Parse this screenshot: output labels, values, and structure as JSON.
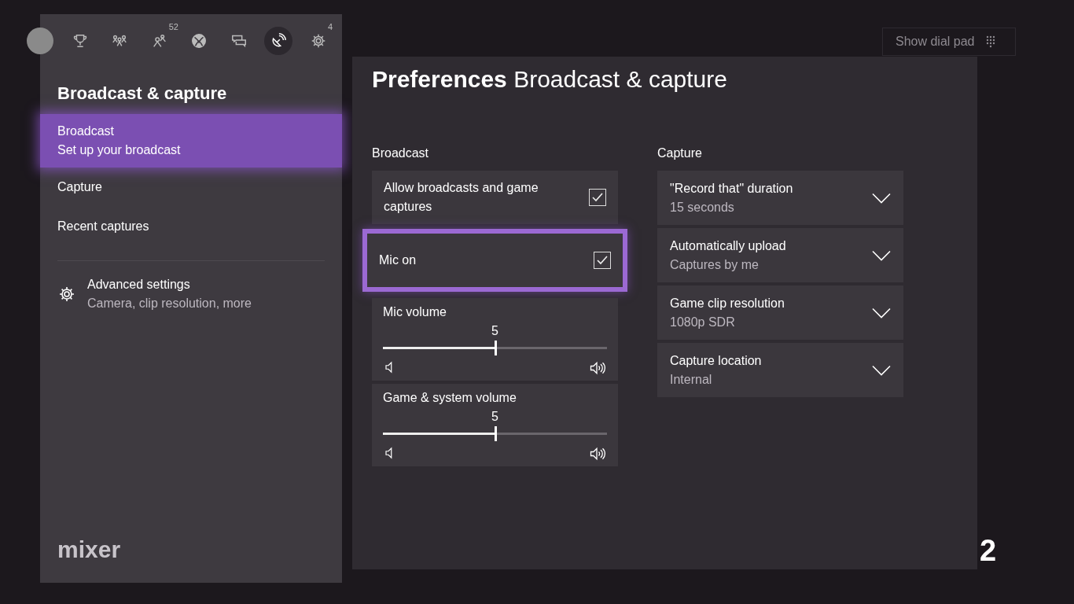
{
  "dial_pad_button": {
    "label": "Show dial pad"
  },
  "background_fragment": "2",
  "guide": {
    "tabs": [
      {
        "kind": "avatar",
        "selected": false
      },
      {
        "kind": "trophy",
        "selected": false
      },
      {
        "kind": "people",
        "selected": false
      },
      {
        "kind": "friends",
        "selected": false,
        "badge": "52"
      },
      {
        "kind": "xbox",
        "selected": false
      },
      {
        "kind": "chat",
        "selected": false
      },
      {
        "kind": "broadcast",
        "selected": true
      },
      {
        "kind": "gear",
        "selected": false,
        "badge": "4"
      }
    ],
    "title": "Broadcast & capture",
    "items": [
      {
        "label": "Broadcast",
        "sublabel": "Set up your broadcast",
        "selected": true
      },
      {
        "label": "Capture",
        "selected": false
      },
      {
        "label": "Recent captures",
        "selected": false
      }
    ],
    "advanced": {
      "label": "Advanced settings",
      "sublabel": "Camera, clip resolution, more"
    },
    "logo": "mixer"
  },
  "page": {
    "title_bold": "Preferences",
    "title": "Broadcast & capture",
    "broadcast": {
      "heading": "Broadcast",
      "items": [
        {
          "kind": "checkbox",
          "label": "Allow broadcasts and game captures",
          "checked": true,
          "focused": false
        },
        {
          "kind": "checkbox",
          "label": "Mic on",
          "checked": true,
          "focused": true
        },
        {
          "kind": "slider",
          "label": "Mic volume",
          "value": "5",
          "level": 0.5
        },
        {
          "kind": "slider",
          "label": "Game & system volume",
          "value": "5",
          "level": 0.5
        }
      ]
    },
    "capture": {
      "heading": "Capture",
      "items": [
        {
          "label": "\"Record that\" duration",
          "value": "15 seconds"
        },
        {
          "label": "Automatically upload",
          "value": "Captures by me"
        },
        {
          "label": "Game clip resolution",
          "value": "1080p SDR"
        },
        {
          "label": "Capture location",
          "value": "Internal"
        }
      ]
    }
  }
}
